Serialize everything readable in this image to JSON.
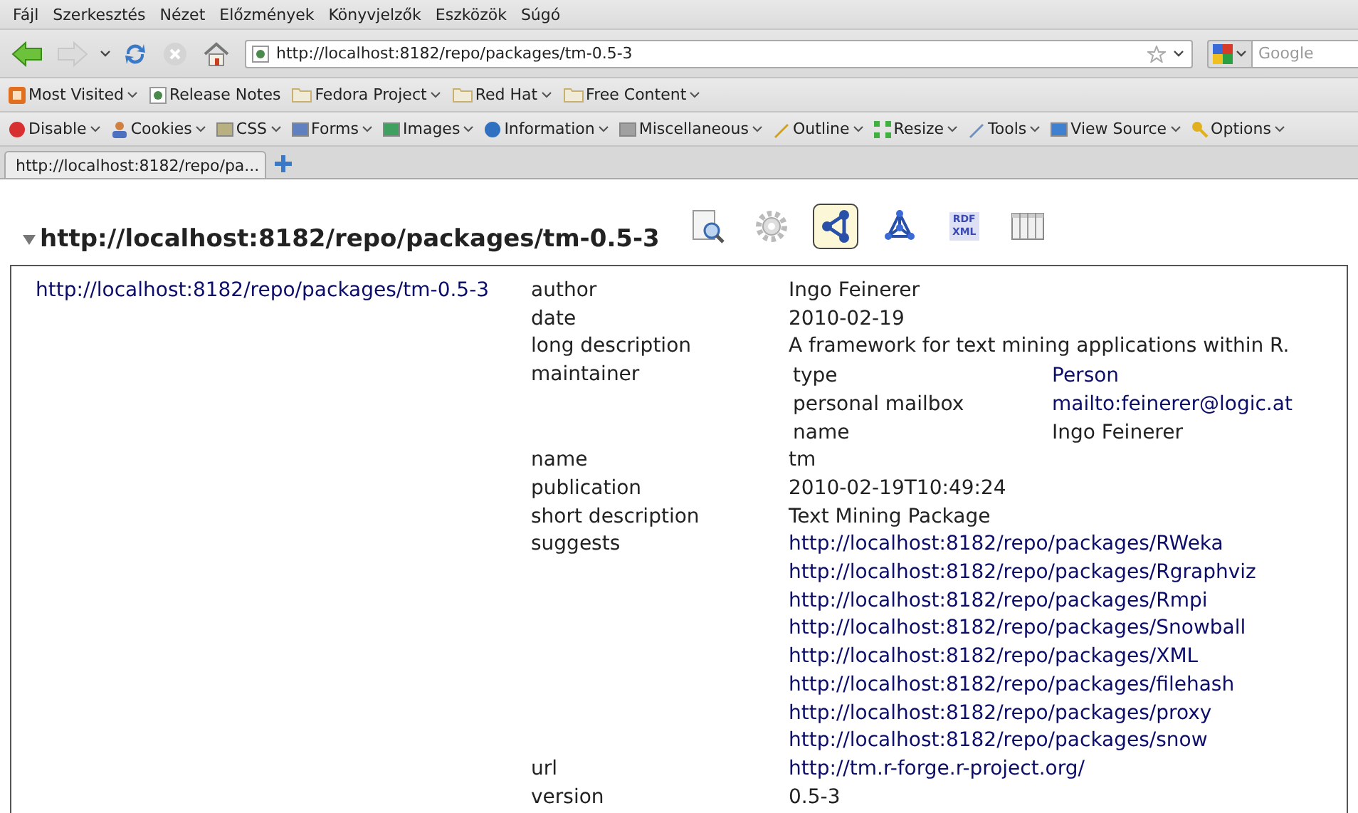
{
  "menu": [
    "Fájl",
    "Szerkesztés",
    "Nézet",
    "Előzmények",
    "Könyvjelzők",
    "Eszközök",
    "Súgó"
  ],
  "nav": {
    "back_disabled": false,
    "forward_disabled": true,
    "stop_disabled": true,
    "url": "http://localhost:8182/repo/packages/tm-0.5-3",
    "search_placeholder": "Google"
  },
  "bookmarks": [
    {
      "label": "Most Visited",
      "kind": "feed",
      "has_menu": true
    },
    {
      "label": "Release Notes",
      "kind": "page",
      "has_menu": false
    },
    {
      "label": "Fedora Project",
      "kind": "folder",
      "has_menu": true
    },
    {
      "label": "Red Hat",
      "kind": "folder",
      "has_menu": true
    },
    {
      "label": "Free Content",
      "kind": "folder",
      "has_menu": true
    }
  ],
  "dev_toolbar": [
    {
      "label": "Disable",
      "kind": "disable"
    },
    {
      "label": "Cookies",
      "kind": "cookies"
    },
    {
      "label": "CSS",
      "kind": "css"
    },
    {
      "label": "Forms",
      "kind": "forms"
    },
    {
      "label": "Images",
      "kind": "images"
    },
    {
      "label": "Information",
      "kind": "info"
    },
    {
      "label": "Miscellaneous",
      "kind": "misc"
    },
    {
      "label": "Outline",
      "kind": "outline"
    },
    {
      "label": "Resize",
      "kind": "resize"
    },
    {
      "label": "Tools",
      "kind": "tools"
    },
    {
      "label": "View Source",
      "kind": "source"
    },
    {
      "label": "Options",
      "kind": "options"
    }
  ],
  "tabs": [
    {
      "title": "http://localhost:8182/repo/pa...",
      "selected": true
    }
  ],
  "heading": {
    "expanded": true,
    "title": "http://localhost:8182/repo/packages/tm-0.5-3"
  },
  "views": [
    {
      "kind": "inspect",
      "selected": false
    },
    {
      "kind": "settings",
      "selected": false
    },
    {
      "kind": "graph",
      "selected": true
    },
    {
      "kind": "network",
      "selected": false
    },
    {
      "kind": "rdf",
      "selected": false,
      "lines": [
        "RDF",
        "XML"
      ]
    },
    {
      "kind": "table",
      "selected": false
    }
  ],
  "subject": "http://localhost:8182/repo/packages/tm-0.5-3",
  "properties": [
    {
      "name": "author",
      "kind": "text",
      "value": "Ingo Feinerer"
    },
    {
      "name": "date",
      "kind": "text",
      "value": "2010-02-19"
    },
    {
      "name": "long description",
      "kind": "text",
      "value": "A framework for text mining applications within R."
    },
    {
      "name": "maintainer",
      "kind": "nested",
      "items": [
        {
          "name": "type",
          "kind": "link",
          "value": "Person"
        },
        {
          "name": "personal mailbox",
          "kind": "link",
          "value": "mailto:feinerer@logic.at"
        },
        {
          "name": "name",
          "kind": "text",
          "value": "Ingo Feinerer"
        }
      ]
    },
    {
      "name": "name",
      "kind": "text",
      "value": "tm"
    },
    {
      "name": "publication",
      "kind": "text",
      "value": "2010-02-19T10:49:24"
    },
    {
      "name": "short description",
      "kind": "text",
      "value": "Text Mining Package"
    },
    {
      "name": "suggests",
      "kind": "links",
      "values": [
        "http://localhost:8182/repo/packages/RWeka",
        "http://localhost:8182/repo/packages/Rgraphviz",
        "http://localhost:8182/repo/packages/Rmpi",
        "http://localhost:8182/repo/packages/Snowball",
        "http://localhost:8182/repo/packages/XML",
        "http://localhost:8182/repo/packages/filehash",
        "http://localhost:8182/repo/packages/proxy",
        "http://localhost:8182/repo/packages/snow"
      ]
    },
    {
      "name": "url",
      "kind": "link",
      "value": "http://tm.r-forge.r-project.org/"
    },
    {
      "name": "version",
      "kind": "text",
      "value": "0.5-3"
    }
  ]
}
